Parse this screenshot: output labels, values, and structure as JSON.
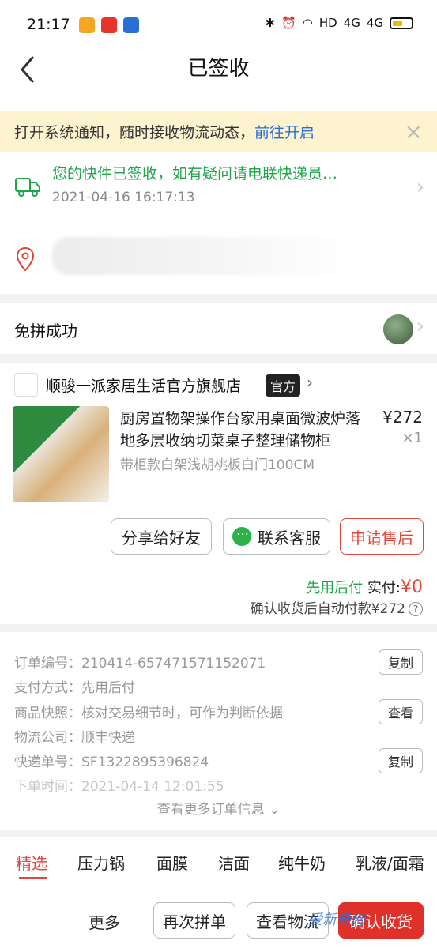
{
  "status_bar": {
    "time": "21:17",
    "right_text": "HD",
    "signal1": "4G",
    "signal2": "4G"
  },
  "nav": {
    "title": "已签收"
  },
  "notice": {
    "text": "打开系统通知，随时接收物流动态，",
    "link": "前往开启"
  },
  "delivery": {
    "message": "您的快件已签收，如有疑问请电联快递员…",
    "time": "2021-04-16 16:17:13"
  },
  "group": {
    "title": "免拼成功"
  },
  "store": {
    "name": "顺骏一派家居生活官方旗舰店",
    "badge": "官方"
  },
  "product": {
    "title": "厨房置物架操作台家用桌面微波炉落地多层收纳切菜桌子整理储物柜",
    "spec": "带柜款白架浅胡桃板白门100CM",
    "price": "¥272",
    "qty": "×1"
  },
  "actions": {
    "share": "分享给好友",
    "service": "联系客服",
    "after_sale": "申请售后"
  },
  "payment": {
    "method_label": "先用后付",
    "paid_label": "实付:",
    "paid_amount": "¥0",
    "note": "确认收货后自动付款¥272"
  },
  "order_info": {
    "rows": [
      {
        "label": "订单编号：",
        "value": "210414-657471571152071",
        "button": "复制"
      },
      {
        "label": "支付方式：",
        "value": "先用后付",
        "button": ""
      },
      {
        "label": "商品快照：",
        "value": "核对交易细节时，可作为判断依据",
        "button": "查看"
      },
      {
        "label": "物流公司：",
        "value": "顺丰快递",
        "button": ""
      },
      {
        "label": "快递单号：",
        "value": "SF1322895396824",
        "button": "复制"
      },
      {
        "label": "下单时间：",
        "value": "2021-04-14 12:01:55",
        "button": ""
      }
    ],
    "more": "查看更多订单信息"
  },
  "tabs": [
    "精选",
    "压力锅",
    "面膜",
    "洁面",
    "纯牛奶",
    "乳液/面霜"
  ],
  "bottom": {
    "more": "更多",
    "rebuy": "再次拼单",
    "logistics": "查看物流",
    "confirm": "确认收货",
    "watermark": "爱新奇网"
  },
  "colors": {
    "accent_red": "#e0463c",
    "green": "#1ea54a",
    "link_blue": "#2a6fd6",
    "notice_bg": "#fdf3cf"
  }
}
